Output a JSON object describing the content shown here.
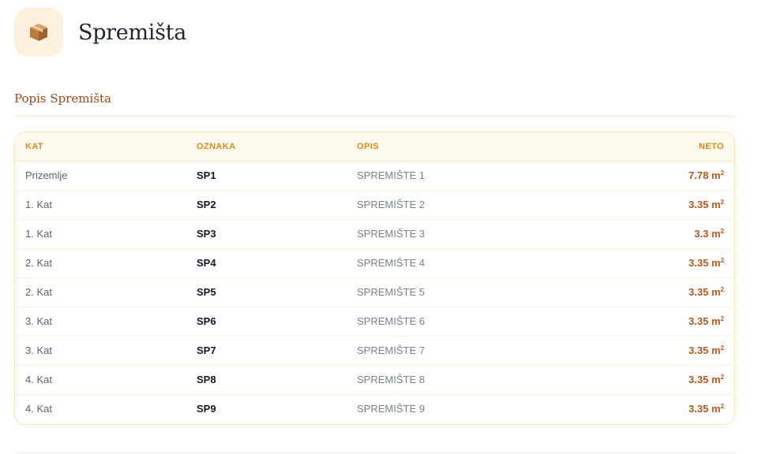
{
  "header": {
    "title": "Spremišta",
    "icon": "package-box-icon"
  },
  "section": {
    "title": "Popis Spremišta"
  },
  "table": {
    "columns": [
      "KAT",
      "OZNAKA",
      "OPIS",
      "NETO"
    ],
    "unit": "m",
    "unit_sup": "2",
    "rows": [
      {
        "kat": "Prizemlje",
        "oznaka": "SP1",
        "opis": "SPREMIŠTE 1",
        "neto": "7.78"
      },
      {
        "kat": "1. Kat",
        "oznaka": "SP2",
        "opis": "SPREMIŠTE 2",
        "neto": "3.35"
      },
      {
        "kat": "1. Kat",
        "oznaka": "SP3",
        "opis": "SPREMIŠTE 3",
        "neto": "3.3"
      },
      {
        "kat": "2. Kat",
        "oznaka": "SP4",
        "opis": "SPREMIŠTE 4",
        "neto": "3.35"
      },
      {
        "kat": "2. Kat",
        "oznaka": "SP5",
        "opis": "SPREMIŠTE 5",
        "neto": "3.35"
      },
      {
        "kat": "3. Kat",
        "oznaka": "SP6",
        "opis": "SPREMIŠTE 6",
        "neto": "3.35"
      },
      {
        "kat": "3. Kat",
        "oznaka": "SP7",
        "opis": "SPREMIŠTE 7",
        "neto": "3.35"
      },
      {
        "kat": "4. Kat",
        "oznaka": "SP8",
        "opis": "SPREMIŠTE 8",
        "neto": "3.35"
      },
      {
        "kat": "4. Kat",
        "oznaka": "SP9",
        "opis": "SPREMIŠTE 9",
        "neto": "3.35"
      }
    ]
  }
}
